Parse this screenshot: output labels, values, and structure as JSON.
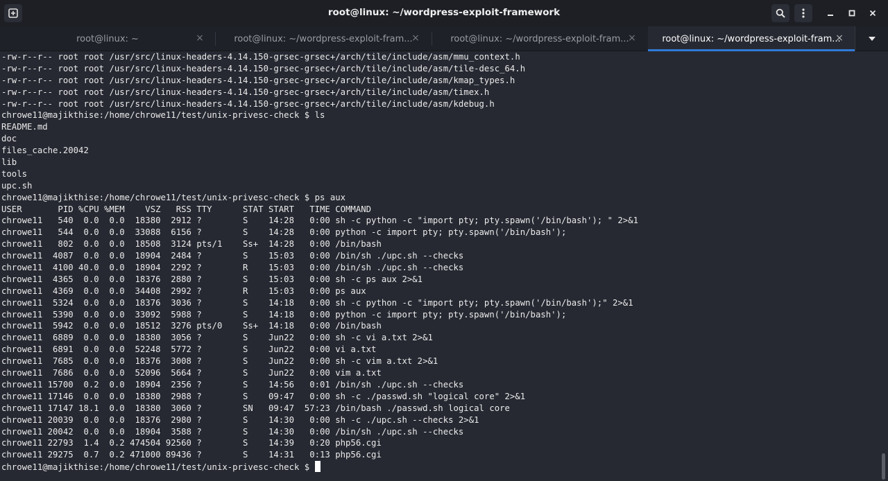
{
  "window": {
    "title": "root@linux: ~/wordpress-exploit-framework"
  },
  "tabs": [
    {
      "label": "root@linux: ~",
      "active": false
    },
    {
      "label": "root@linux: ~/wordpress-exploit-fram...",
      "active": false
    },
    {
      "label": "root@linux: ~/wordpress-exploit-fram...",
      "active": false
    },
    {
      "label": "root@linux: ~/wordpress-exploit-fram...",
      "active": true
    }
  ],
  "tab_close_glyph": "×",
  "terminal": {
    "lines": [
      "-rw-r--r-- root root /usr/src/linux-headers-4.14.150-grsec-grsec+/arch/tile/include/asm/mmu_context.h",
      "-rw-r--r-- root root /usr/src/linux-headers-4.14.150-grsec-grsec+/arch/tile/include/asm/tile-desc_64.h",
      "-rw-r--r-- root root /usr/src/linux-headers-4.14.150-grsec-grsec+/arch/tile/include/asm/kmap_types.h",
      "-rw-r--r-- root root /usr/src/linux-headers-4.14.150-grsec-grsec+/arch/tile/include/asm/timex.h",
      "-rw-r--r-- root root /usr/src/linux-headers-4.14.150-grsec-grsec+/arch/tile/include/asm/kdebug.h",
      "chrowe11@majikthise:/home/chrowe11/test/unix-privesc-check $ ls",
      "README.md",
      "doc",
      "files_cache.20042",
      "lib",
      "tools",
      "upc.sh",
      "chrowe11@majikthise:/home/chrowe11/test/unix-privesc-check $ ps aux",
      "USER       PID %CPU %MEM    VSZ   RSS TTY      STAT START   TIME COMMAND",
      "chrowe11   540  0.0  0.0  18380  2912 ?        S    14:28   0:00 sh -c python -c \"import pty; pty.spawn('/bin/bash'); \" 2>&1",
      "chrowe11   544  0.0  0.0  33088  6156 ?        S    14:28   0:00 python -c import pty; pty.spawn('/bin/bash');",
      "chrowe11   802  0.0  0.0  18508  3124 pts/1    Ss+  14:28   0:00 /bin/bash",
      "chrowe11  4087  0.0  0.0  18904  2484 ?        S    15:03   0:00 /bin/sh ./upc.sh --checks",
      "chrowe11  4100 40.0  0.0  18904  2292 ?        R    15:03   0:00 /bin/sh ./upc.sh --checks",
      "chrowe11  4365  0.0  0.0  18376  2880 ?        S    15:03   0:00 sh -c ps aux 2>&1",
      "chrowe11  4369  0.0  0.0  34408  2992 ?        R    15:03   0:00 ps aux",
      "chrowe11  5324  0.0  0.0  18376  3036 ?        S    14:18   0:00 sh -c python -c \"import pty; pty.spawn('/bin/bash');\" 2>&1",
      "chrowe11  5390  0.0  0.0  33092  5988 ?        S    14:18   0:00 python -c import pty; pty.spawn('/bin/bash');",
      "chrowe11  5942  0.0  0.0  18512  3276 pts/0    Ss+  14:18   0:00 /bin/bash",
      "chrowe11  6889  0.0  0.0  18380  3056 ?        S    Jun22   0:00 sh -c vi a.txt 2>&1",
      "chrowe11  6891  0.0  0.0  52248  5772 ?        S    Jun22   0:00 vi a.txt",
      "chrowe11  7685  0.0  0.0  18376  3008 ?        S    Jun22   0:00 sh -c vim a.txt 2>&1",
      "chrowe11  7686  0.0  0.0  52096  5664 ?        S    Jun22   0:00 vim a.txt",
      "chrowe11 15700  0.2  0.0  18904  2356 ?        S    14:56   0:01 /bin/sh ./upc.sh --checks",
      "chrowe11 17146  0.0  0.0  18380  2988 ?        S    09:47   0:00 sh -c ./passwd.sh \"logical core\" 2>&1",
      "chrowe11 17147 18.1  0.0  18380  3060 ?        SN   09:47  57:23 /bin/bash ./passwd.sh logical core",
      "chrowe11 20039  0.0  0.0  18376  2980 ?        S    14:30   0:00 sh -c ./upc.sh --checks 2>&1",
      "chrowe11 20042  0.0  0.0  18904  3588 ?        S    14:30   0:00 /bin/sh ./upc.sh --checks",
      "chrowe11 22793  1.4  0.2 474504 92560 ?        S    14:39   0:20 php56.cgi",
      "chrowe11 29275  0.7  0.2 471000 89436 ?        S    14:31   0:13 php56.cgi"
    ],
    "prompt": "chrowe11@majikthise:/home/chrowe11/test/unix-privesc-check $ "
  }
}
